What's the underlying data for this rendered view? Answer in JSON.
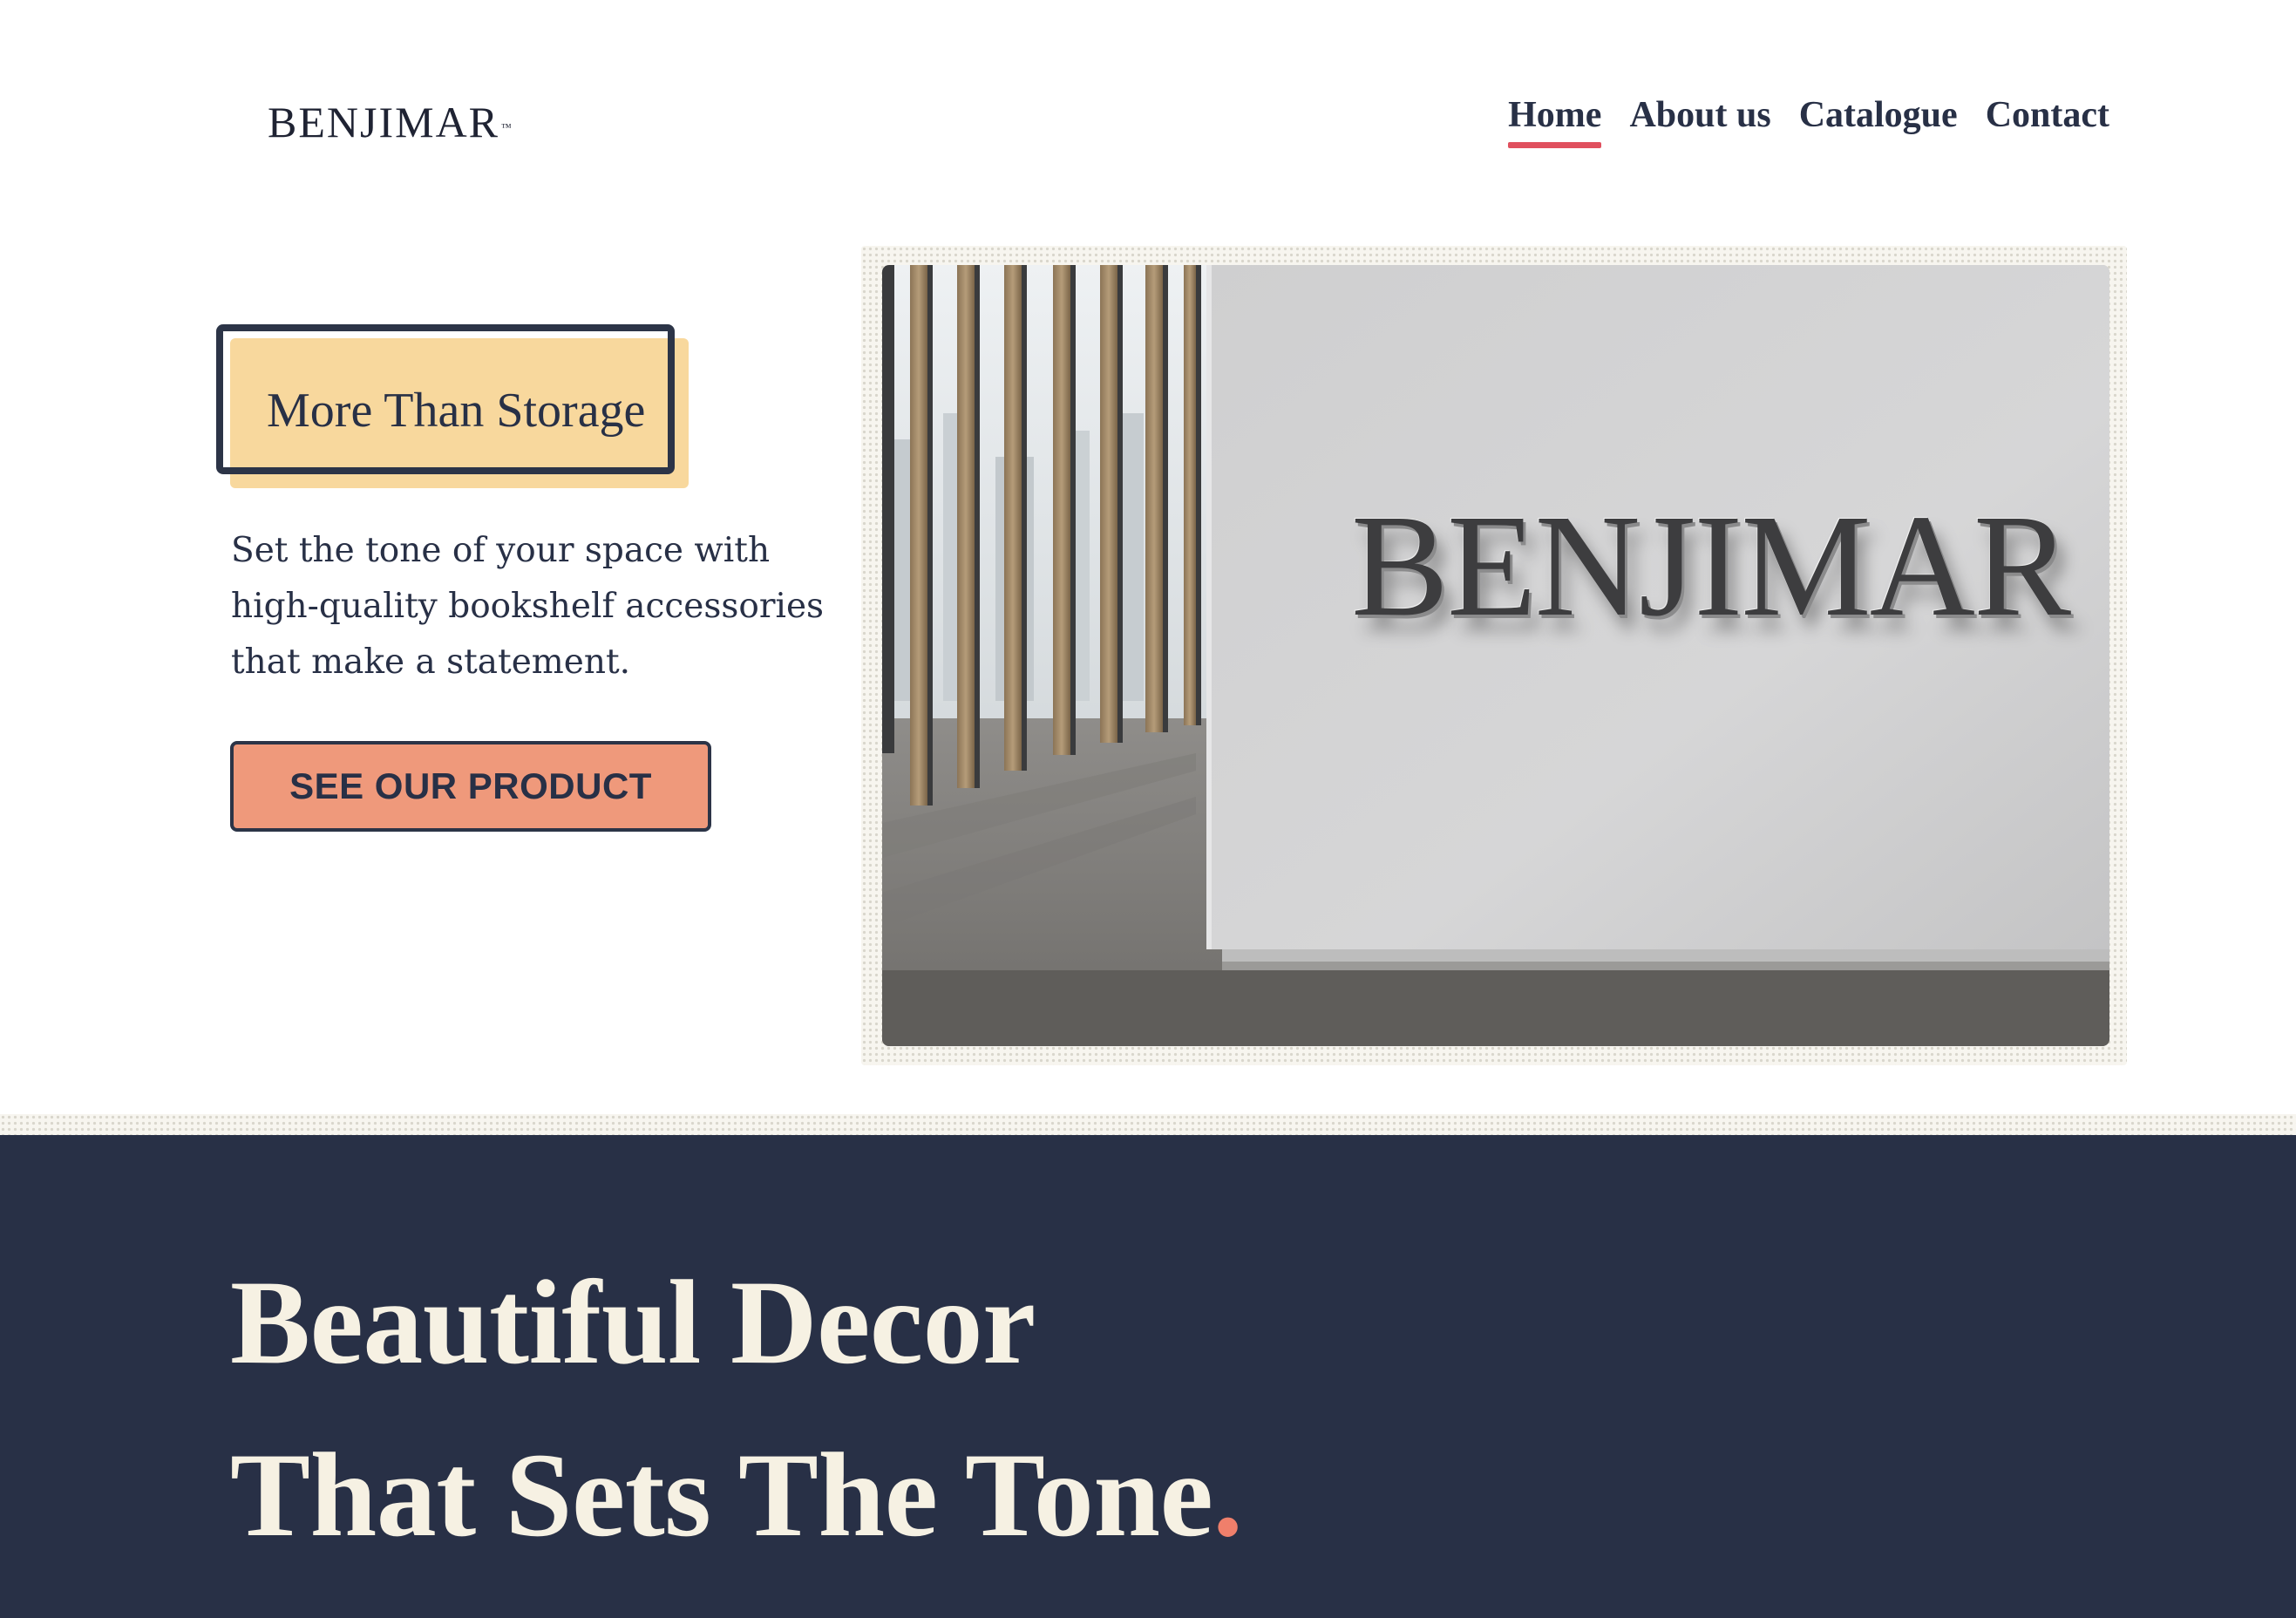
{
  "header": {
    "logo_text": "BENJIMAR",
    "logo_tm": "™",
    "nav": [
      {
        "label": "Home",
        "active": true
      },
      {
        "label": "About us",
        "active": false
      },
      {
        "label": "Catalogue",
        "active": false
      },
      {
        "label": "Contact",
        "active": false
      }
    ]
  },
  "hero": {
    "tag": "More Than Storage",
    "copy": "Set the tone of your space with high-quality bookshelf accessories that make a statement.",
    "cta_label": "SEE OUR PRODUCT",
    "image_brand_text": "BENJIMAR"
  },
  "feature": {
    "headline_line1": "Beautiful Decor",
    "headline_line2": "That Sets The Tone",
    "headline_period": "."
  },
  "colors": {
    "navy": "#283046",
    "tag_yellow": "#f8d89d",
    "cta_salmon": "#ef997b",
    "nav_underline": "#e0505e",
    "cream_text": "#f6f1e3",
    "accent_dot": "#ef7f6b"
  }
}
